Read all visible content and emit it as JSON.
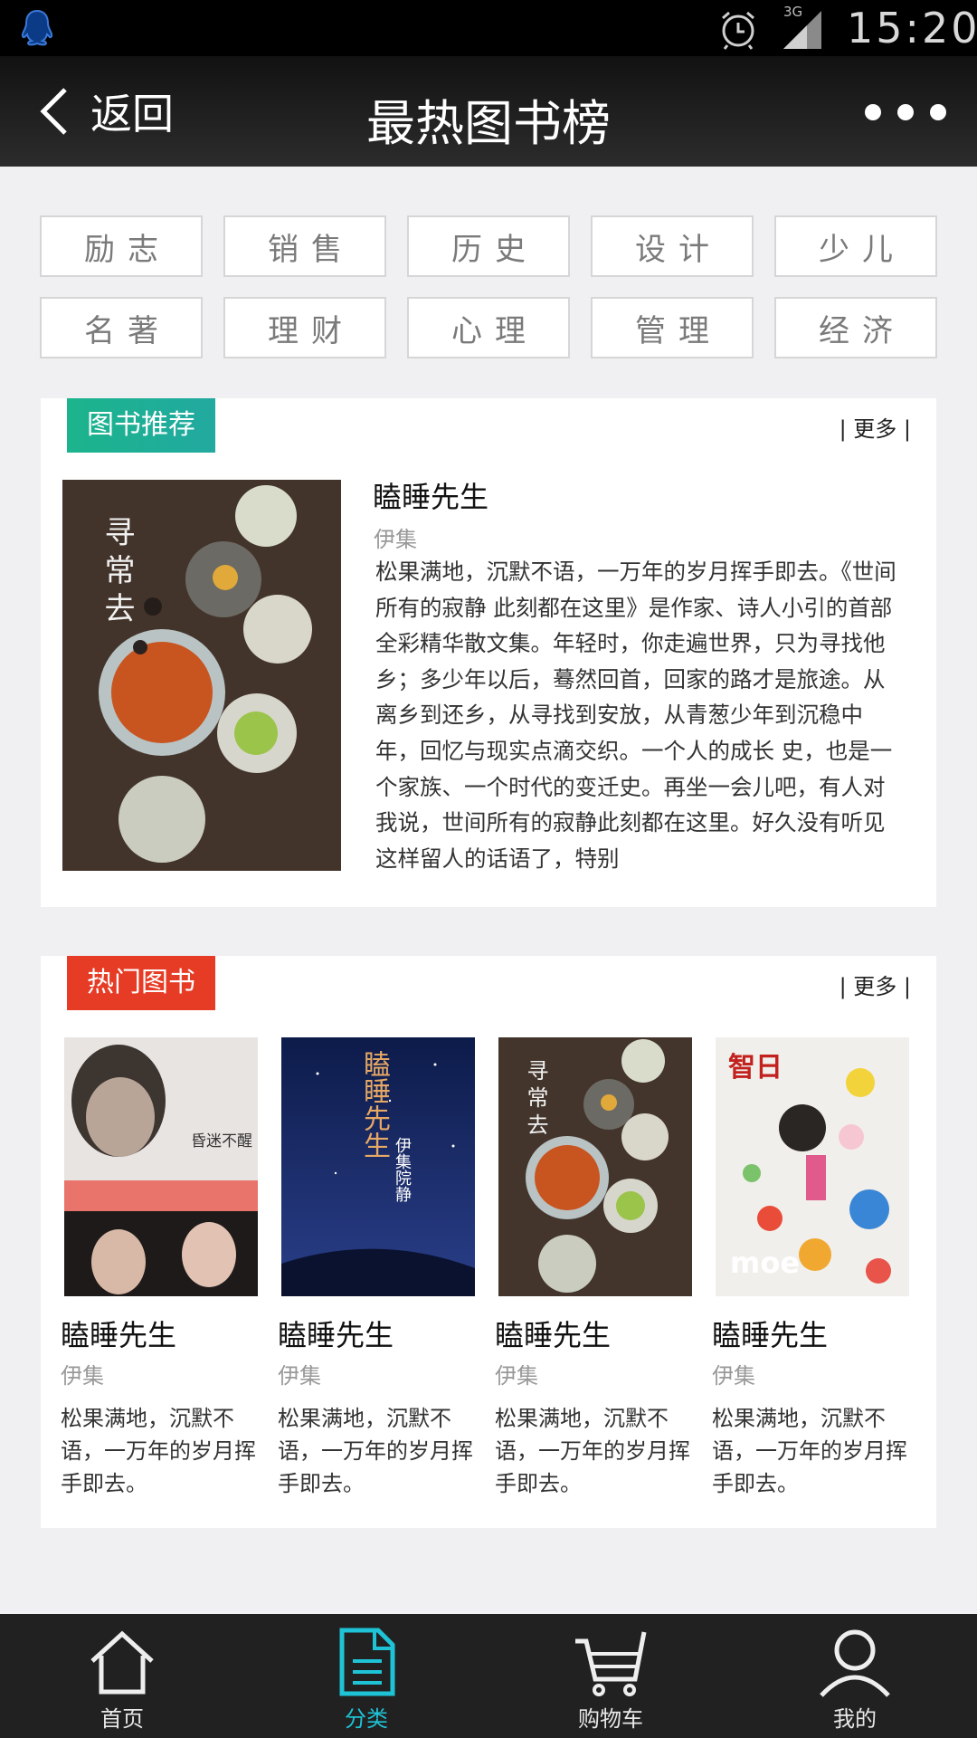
{
  "status": {
    "time": "15:20",
    "network": "3G"
  },
  "nav": {
    "back_label": "返回",
    "title": "最热图书榜"
  },
  "categories": [
    "励志",
    "销售",
    "历史",
    "设计",
    "少儿",
    "名著",
    "理财",
    "心理",
    "管理",
    "经济"
  ],
  "recommend": {
    "tag": "图书推荐",
    "more": "| 更多 |",
    "book": {
      "cover_text": "寻常去",
      "title": "瞌睡先生",
      "author": "伊集",
      "description": "松果满地，沉默不语，一万年的岁月挥手即去。《世间所有的寂静 此刻都在这里》是作家、诗人小引的首部全彩精华散文集。年轻时，你走遍世界，只为寻找他乡；多少年以后，蓦然回首，回家的路才是旅途。从离乡到还乡，从寻找到安放，从青葱少年到沉稳中年，回忆与现实点滴交织。一个人的成长 史，也是一个家族、一个时代的变迁史。再坐一会儿吧，有人对我说，世间所有的寂静此刻都在这里。好久没有听见这样留人的话语了，特别"
    }
  },
  "hot": {
    "tag": "热门图书",
    "more": "| 更多 |",
    "books": [
      {
        "cover_text": "昏迷不醒",
        "title": "瞌睡先生",
        "author": "伊集",
        "description": "松果满地，沉默不语，一万年的岁月挥手即去。"
      },
      {
        "cover_text": "瞌睡先生",
        "cover_author": "伊集院静",
        "title": "瞌睡先生",
        "author": "伊集",
        "description": "松果满地，沉默不语，一万年的岁月挥手即去。"
      },
      {
        "cover_text": "寻常去",
        "title": "瞌睡先生",
        "author": "伊集",
        "description": "松果满地，沉默不语，一万年的岁月挥手即去。"
      },
      {
        "cover_text": "智日",
        "cover_sub": "moe",
        "title": "瞌睡先生",
        "author": "伊集",
        "description": "松果满地，沉默不语，一万年的岁月挥手即去。"
      }
    ]
  },
  "tabs": [
    {
      "label": "首页",
      "icon": "home-icon"
    },
    {
      "label": "分类",
      "icon": "category-document-icon",
      "active": true
    },
    {
      "label": "购物车",
      "icon": "cart-icon"
    },
    {
      "label": "我的",
      "icon": "user-icon"
    }
  ],
  "colors": {
    "accent": "#1ec3d6",
    "tag_green": "#1bb48c",
    "tag_red": "#e63b25"
  }
}
